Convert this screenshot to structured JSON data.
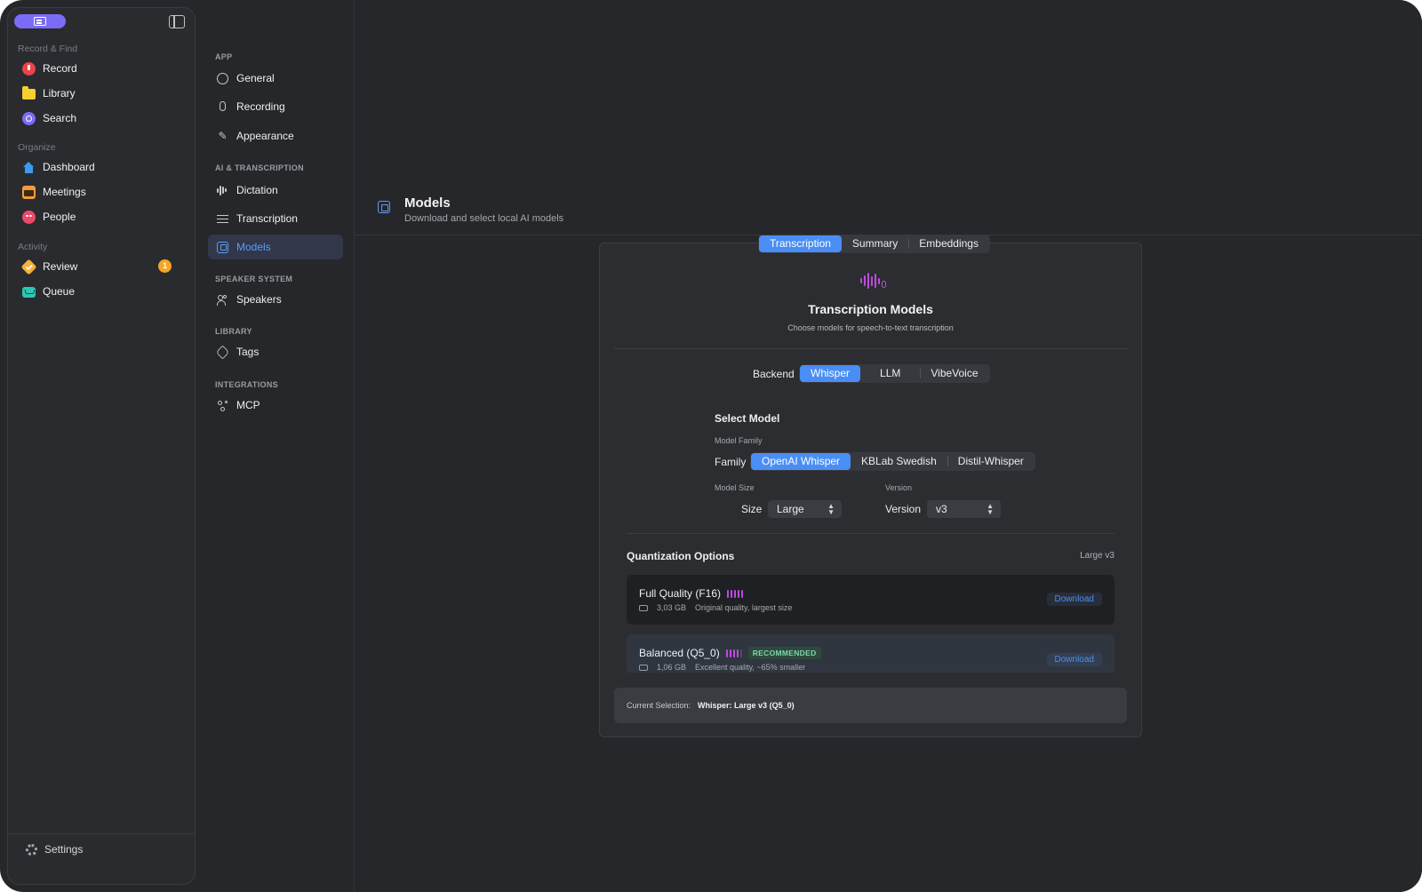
{
  "sidebar": {
    "sections": [
      {
        "label": "Record & Find",
        "items": [
          {
            "label": "Record",
            "icon": "record-icon"
          },
          {
            "label": "Library",
            "icon": "folder-icon"
          },
          {
            "label": "Search",
            "icon": "search-icon"
          }
        ]
      },
      {
        "label": "Organize",
        "items": [
          {
            "label": "Dashboard",
            "icon": "home-icon"
          },
          {
            "label": "Meetings",
            "icon": "calendar-icon"
          },
          {
            "label": "People",
            "icon": "people-icon"
          }
        ]
      },
      {
        "label": "Activity",
        "items": [
          {
            "label": "Review",
            "icon": "review-check-icon",
            "badge": "1"
          },
          {
            "label": "Queue",
            "icon": "inbox-tray-icon"
          }
        ]
      }
    ],
    "settings_label": "Settings"
  },
  "settings_nav": {
    "sections": [
      {
        "label": "APP",
        "items": [
          {
            "label": "General"
          },
          {
            "label": "Recording"
          },
          {
            "label": "Appearance"
          }
        ]
      },
      {
        "label": "AI & TRANSCRIPTION",
        "items": [
          {
            "label": "Dictation"
          },
          {
            "label": "Transcription"
          },
          {
            "label": "Models",
            "active": true
          }
        ]
      },
      {
        "label": "SPEAKER SYSTEM",
        "items": [
          {
            "label": "Speakers"
          }
        ]
      },
      {
        "label": "LIBRARY",
        "items": [
          {
            "label": "Tags"
          }
        ]
      },
      {
        "label": "INTEGRATIONS",
        "items": [
          {
            "label": "MCP"
          }
        ]
      }
    ]
  },
  "header": {
    "title": "Models",
    "subtitle": "Download and select local AI models"
  },
  "tabs": [
    "Transcription",
    "Summary",
    "Embeddings"
  ],
  "panel": {
    "title": "Transcription Models",
    "subtitle": "Choose models for speech-to-text transcription",
    "backend_label": "Backend",
    "backends": [
      "Whisper",
      "LLM",
      "VibeVoice"
    ],
    "select_model_title": "Select Model",
    "model_family_label": "Model Family",
    "family_label": "Family",
    "families": [
      "OpenAI Whisper",
      "KBLab Swedish",
      "Distil-Whisper"
    ],
    "model_size_label": "Model Size",
    "size_label": "Size",
    "size_value": "Large",
    "version_caption": "Version",
    "version_label": "Version",
    "version_value": "v3",
    "quant_title": "Quantization Options",
    "quant_selection": "Large v3",
    "options": [
      {
        "name": "Full Quality (F16)",
        "quality_bars": 5,
        "size": "3,03 GB",
        "description": "Original quality, largest size",
        "action": "Download"
      },
      {
        "name": "Balanced (Q5_0)",
        "quality_bars": 4,
        "badge": "RECOMMENDED",
        "size": "1,06 GB",
        "description": "Excellent quality, ~65% smaller",
        "action": "Download"
      }
    ],
    "current_selection_label": "Current Selection:",
    "current_selection_value": "Whisper: Large v3 (Q5_0)"
  },
  "colors": {
    "accent": "#4a8ef5",
    "purple": "#c04ae0",
    "background": "#26272a"
  }
}
